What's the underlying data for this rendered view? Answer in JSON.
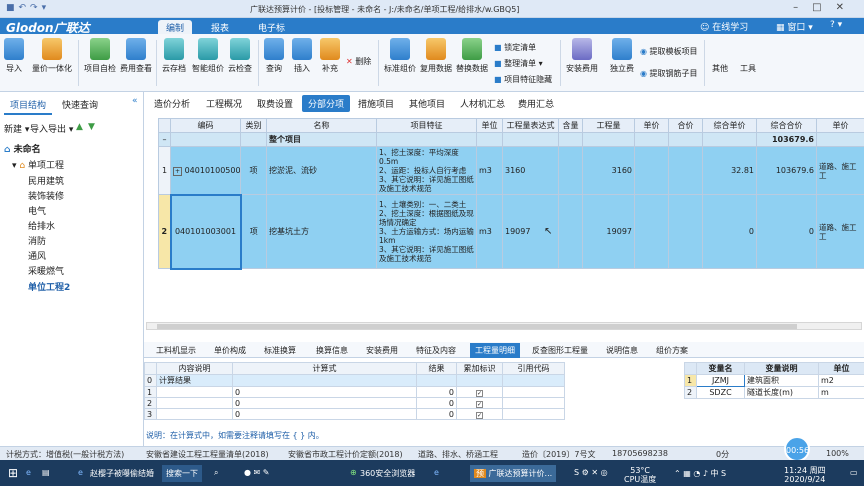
{
  "window": {
    "title": "广联达预算计价 - [投标管理 - 未命名 - J:/未命名/单项工程/给排水/w.GBQ5]"
  },
  "quick_access": {
    "icons": [
      "save-icon",
      "undo-icon",
      "redo-icon",
      "dropdown-icon"
    ]
  },
  "menubar": {
    "logo": "Glodon广联达",
    "tabs": [
      {
        "label": "编制",
        "active": true
      },
      {
        "label": "报表"
      },
      {
        "label": "电子标"
      }
    ],
    "right": {
      "online": "在线学习",
      "window": "窗口"
    }
  },
  "ribbon": {
    "buttons": [
      {
        "label": "导入",
        "icon": "import-icon"
      },
      {
        "label": "量价一体化",
        "icon": "integration-icon"
      },
      {
        "label": "项目自检",
        "icon": "self-check-icon"
      },
      {
        "label": "费用查看",
        "icon": "cost-view-icon"
      },
      {
        "label": "云存档",
        "icon": "cloud-save-icon"
      },
      {
        "label": "智能组价",
        "icon": "smart-price-icon"
      },
      {
        "label": "云检查",
        "icon": "cloud-check-icon"
      },
      {
        "label": "查询",
        "icon": "query-icon"
      },
      {
        "label": "插入",
        "icon": "insert-icon"
      },
      {
        "label": "补充",
        "icon": "supplement-icon"
      },
      {
        "label": "标准组价",
        "icon": "standard-price-icon"
      },
      {
        "label": "复用数据",
        "icon": "reuse-data-icon"
      },
      {
        "label": "替换数据",
        "icon": "replace-data-icon"
      },
      {
        "label": "安装费用",
        "icon": "install-cost-icon"
      },
      {
        "label": "独立费",
        "icon": "independent-fee-icon"
      },
      {
        "label": "其他",
        "icon": "other-icon"
      },
      {
        "label": "工具",
        "icon": "tools-icon"
      }
    ],
    "delete_label": "删除",
    "small": {
      "lock": "锁定清单",
      "organize": "整理清单",
      "hide": "项目特征隐藏",
      "extract_template": "提取模板项目",
      "extract_sub": "提取钢筋子目"
    }
  },
  "sidebar": {
    "tabs": [
      {
        "label": "项目结构",
        "active": true
      },
      {
        "label": "快速查询"
      }
    ],
    "toolbar": {
      "new": "新建",
      "import_export": "导入导出"
    },
    "tree": [
      {
        "label": "未命名",
        "level": 0
      },
      {
        "label": "单项工程",
        "level": 1
      },
      {
        "label": "民用建筑",
        "level": 2
      },
      {
        "label": "装饰装修",
        "level": 2
      },
      {
        "label": "电气",
        "level": 2
      },
      {
        "label": "给排水",
        "level": 2
      },
      {
        "label": "消防",
        "level": 2
      },
      {
        "label": "通风",
        "level": 2
      },
      {
        "label": "采暖燃气",
        "level": 2
      },
      {
        "label": "单位工程2",
        "level": 2,
        "selected": true
      }
    ]
  },
  "main_tabs": [
    {
      "label": "造价分析"
    },
    {
      "label": "工程概况"
    },
    {
      "label": "取费设置"
    },
    {
      "label": "分部分项",
      "active": true
    },
    {
      "label": "措施项目"
    },
    {
      "label": "其他项目"
    },
    {
      "label": "人材机汇总"
    },
    {
      "label": "费用汇总"
    }
  ],
  "grid": {
    "headers": [
      "",
      "编码",
      "类别",
      "名称",
      "项目特征",
      "单位",
      "工程量表达式",
      "含量",
      "工程量",
      "单价",
      "合价",
      "综合单价",
      "综合合价",
      "单价"
    ],
    "summary_row": {
      "marker": "–",
      "name": "整个项目",
      "total": "103679.6"
    },
    "rows": [
      {
        "no": "1",
        "code": "040101005001",
        "type": "项",
        "name": "挖淤泥、流砂",
        "features": "1、挖土深度：平均深度0.5m\n2、运距：投标人自行考虑\n3、其它说明：详见施工图纸及施工技术规范",
        "unit": "m3",
        "expr": "3160",
        "content": "",
        "qty": "3160",
        "price": "",
        "total": "",
        "unit_price": "32.81",
        "sum": "103679.6",
        "extra": "道路、施工工"
      },
      {
        "no": "2",
        "code": "040101003001",
        "type": "项",
        "name": "挖基坑土方",
        "features": "1、土壤类别：一、二类土\n2、挖土深度：根据图纸及现场情况确定\n3、土方运输方式：场内运输1km\n3、其它说明：详见施工图纸及施工技术规范",
        "unit": "m3",
        "expr": "19097",
        "content": "",
        "qty": "19097",
        "price": "",
        "total": "",
        "unit_price": "0",
        "sum": "0",
        "extra": "道路、施工工"
      }
    ]
  },
  "bottom_tabs": [
    {
      "label": "工料机显示"
    },
    {
      "label": "单价构成"
    },
    {
      "label": "标准换算"
    },
    {
      "label": "换算信息"
    },
    {
      "label": "安装费用"
    },
    {
      "label": "特征及内容"
    },
    {
      "label": "工程量明细",
      "active": true
    },
    {
      "label": "反查图形工程量"
    },
    {
      "label": "说明信息"
    },
    {
      "label": "组价方案"
    }
  ],
  "calc_table": {
    "headers": [
      "",
      "内容说明",
      "计算式",
      "结果",
      "累加标识",
      "引用代码"
    ],
    "rows": [
      {
        "no": "0",
        "desc": "计算结果",
        "formula": "",
        "result": "",
        "checked": false,
        "ref": ""
      },
      {
        "no": "1",
        "desc": "",
        "formula": "0",
        "result": "0",
        "checked": true,
        "ref": ""
      },
      {
        "no": "2",
        "desc": "",
        "formula": "0",
        "result": "0",
        "checked": true,
        "ref": ""
      },
      {
        "no": "3",
        "desc": "",
        "formula": "0",
        "result": "0",
        "checked": true,
        "ref": ""
      }
    ]
  },
  "vars_table": {
    "headers": [
      "",
      "变量名",
      "变量说明",
      "单位"
    ],
    "rows": [
      {
        "no": "1",
        "name": "JZMJ",
        "desc": "建筑面积",
        "unit": "m2"
      },
      {
        "no": "2",
        "name": "SDZC",
        "desc": "隧道长度(m)",
        "unit": "m"
      }
    ]
  },
  "note": "说明：在计算式中，如需要注释请填写在 { } 内。",
  "statusbar": {
    "tax": "计税方式：增值税(一般计税方法)",
    "list": "安徽省建设工程工程量清单(2018)",
    "quota": "安徽省市政工程计价定额(2018)",
    "category": "道路、排水、桥涵工程",
    "price_doc": "造价〔2019〕7号文",
    "phone": "18705698238",
    "score": "0分",
    "zoom": "100%"
  },
  "timer": "00:56",
  "taskbar": {
    "items": [
      {
        "label": "赵樱子被曝偷结婚"
      },
      {
        "label": "搜索一下"
      },
      {
        "label": "360安全浏览器"
      },
      {
        "label": "广联达预算计价..."
      }
    ],
    "temp": "53°C",
    "temp_label": "CPU温度",
    "time": "11:24 周四",
    "date": "2020/9/24"
  }
}
